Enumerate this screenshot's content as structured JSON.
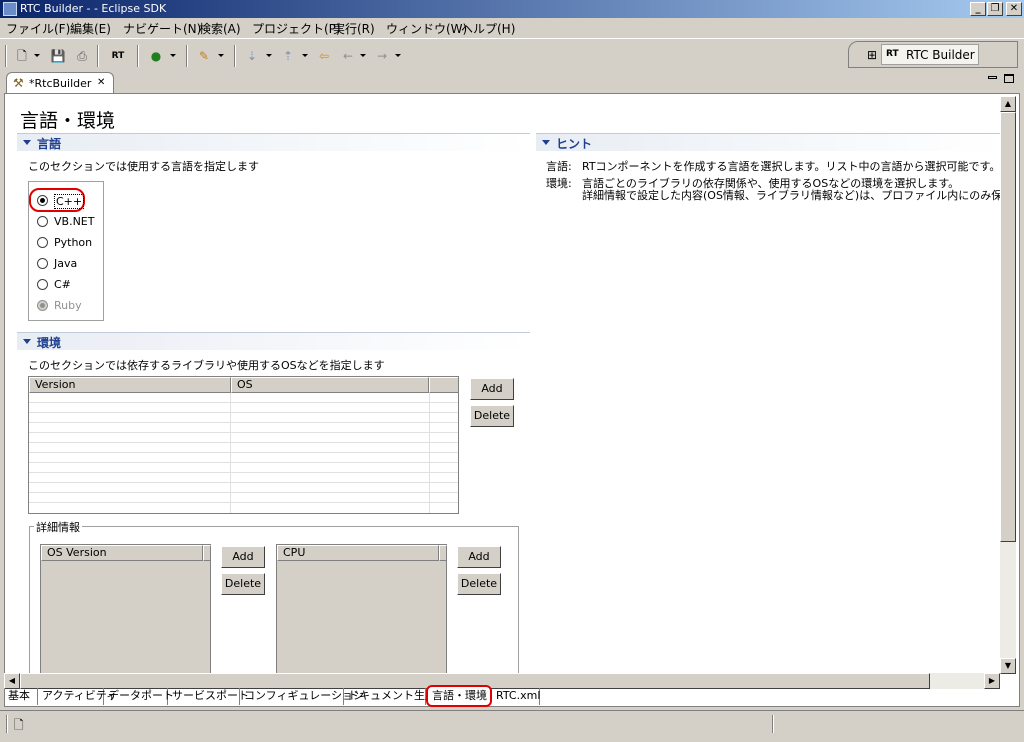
{
  "window": {
    "title": "RTC Builder -  - Eclipse SDK",
    "controls": [
      "_",
      "❐",
      "✕"
    ]
  },
  "menu": [
    "ファイル(F)",
    "編集(E)",
    "ナビゲート(N)",
    "検索(A)",
    "プロジェクト(P)",
    "実行(R)",
    "ウィンドウ(W)",
    "ヘルプ(H)"
  ],
  "perspective": {
    "label": "RTC Builder"
  },
  "editor_tab": {
    "label": "*RtcBuilder",
    "close": "✕"
  },
  "page": {
    "title": "言語・環境"
  },
  "language_section": {
    "title": "言語",
    "desc": "このセクションでは使用する言語を指定します",
    "options": [
      "C++",
      "VB.NET",
      "Python",
      "Java",
      "C#",
      "Ruby"
    ],
    "selected": "C++"
  },
  "hint_section": {
    "title": "ヒント",
    "line1_key": "言語:",
    "line1_text": "RTコンポーネントを作成する言語を選択します。リスト中の言語から選択可能です。",
    "line2_key": "環境:",
    "line2_text": "言語ごとのライブラリの依存関係や、使用するOSなどの環境を選択します。",
    "line3_text": "詳細情報で設定した内容(OS情報、ライブラリ情報など)は、プロファイル内にのみ保存され"
  },
  "env_section": {
    "title": "環境",
    "desc": "このセクションでは依存するライブラリや使用するOSなどを指定します",
    "columns": [
      "Version",
      "OS",
      ""
    ],
    "add_label": "Add",
    "delete_label": "Delete"
  },
  "details": {
    "title": "詳細情報",
    "os_version_col": "OS Version",
    "cpu_col": "CPU",
    "add_label": "Add",
    "delete_label": "Delete"
  },
  "bottom_tabs": [
    "基本",
    "アクティビティ",
    "データポート",
    "サービスポート",
    "コンフィギュレーション",
    "ドキュメント生成",
    "言語・環境",
    "RTC.xml"
  ],
  "active_bottom_tab": "言語・環境",
  "colors": {
    "section_header": "#1f3f8f",
    "highlight": "#e00000",
    "titlebar": "#0a246a"
  }
}
